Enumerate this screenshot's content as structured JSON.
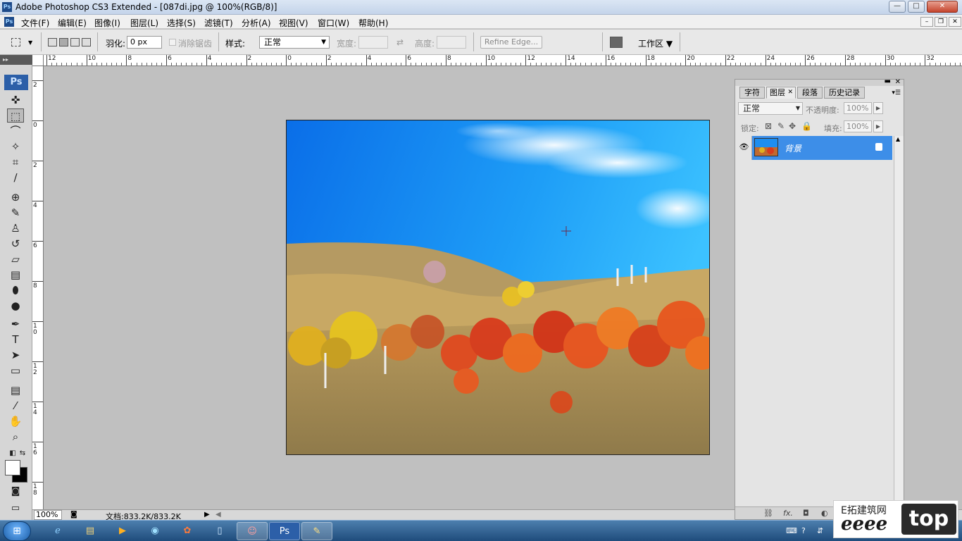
{
  "window": {
    "title": "Adobe Photoshop CS3 Extended - [087di.jpg @ 100%(RGB/8)]",
    "app_icon": "Ps",
    "min_label": "—",
    "max_label": "□",
    "close_label": "✕"
  },
  "menu": {
    "items": [
      "文件(F)",
      "编辑(E)",
      "图像(I)",
      "图层(L)",
      "选择(S)",
      "滤镜(T)",
      "分析(A)",
      "视图(V)",
      "窗口(W)",
      "帮助(H)"
    ],
    "doc_min": "–",
    "doc_restore": "❐",
    "doc_close": "✕"
  },
  "options": {
    "feather_label": "羽化:",
    "feather_value": "0 px",
    "antialias_label": "消除锯齿",
    "style_label": "样式:",
    "style_value": "正常",
    "width_label": "宽度:",
    "height_label": "高度:",
    "refine_edge": "Refine Edge...",
    "workspace_label": "工作区 ▼"
  },
  "toolbox": {
    "logo": "Ps",
    "tools": [
      {
        "name": "move-tool",
        "glyph": "✜"
      },
      {
        "name": "marquee-tool",
        "glyph": "⬚"
      },
      {
        "name": "lasso-tool",
        "glyph": "⌒"
      },
      {
        "name": "magic-wand-tool",
        "glyph": "✧"
      },
      {
        "name": "crop-tool",
        "glyph": "⌗"
      },
      {
        "name": "slice-tool",
        "glyph": "∕"
      },
      {
        "name": "healing-brush-tool",
        "glyph": "⊕"
      },
      {
        "name": "brush-tool",
        "glyph": "✎"
      },
      {
        "name": "clone-stamp-tool",
        "glyph": "♙"
      },
      {
        "name": "history-brush-tool",
        "glyph": "↺"
      },
      {
        "name": "eraser-tool",
        "glyph": "▱"
      },
      {
        "name": "gradient-tool",
        "glyph": "▤"
      },
      {
        "name": "blur-tool",
        "glyph": "⬮"
      },
      {
        "name": "dodge-tool",
        "glyph": "●"
      },
      {
        "name": "pen-tool",
        "glyph": "✒"
      },
      {
        "name": "type-tool",
        "glyph": "T"
      },
      {
        "name": "path-selection-tool",
        "glyph": "➤"
      },
      {
        "name": "shape-tool",
        "glyph": "▭"
      },
      {
        "name": "notes-tool",
        "glyph": "▤"
      },
      {
        "name": "eyedropper-tool",
        "glyph": "⁄"
      },
      {
        "name": "hand-tool",
        "glyph": "✋"
      },
      {
        "name": "zoom-tool",
        "glyph": "⌕"
      }
    ]
  },
  "rulers": {
    "top_labels": [
      "12",
      "10",
      "8",
      "6",
      "4",
      "2",
      "0",
      "2",
      "4",
      "6",
      "8",
      "10",
      "12",
      "14",
      "16",
      "18",
      "20",
      "22",
      "24",
      "26",
      "28",
      "30",
      "32"
    ],
    "left_labels": [
      "2",
      "0",
      "2",
      "4",
      "6",
      "8",
      "10",
      "12",
      "14",
      "16",
      "18"
    ]
  },
  "status": {
    "zoom": "100%",
    "doc_info": "文档:833.2K/833.2K"
  },
  "layers_panel": {
    "tabs": [
      "字符",
      "图层",
      "段落",
      "历史记录"
    ],
    "active_tab": "图层",
    "blend_mode": "正常",
    "opacity_label": "不透明度:",
    "opacity_value": "100%",
    "lock_label": "锁定:",
    "fill_label": "填充:",
    "fill_value": "100%",
    "layers": [
      {
        "name": "背景",
        "visible": true,
        "locked": true
      }
    ],
    "footer_icons": [
      "link-icon",
      "fx-icon",
      "mask-icon",
      "adjustment-icon"
    ]
  },
  "watermark": {
    "cn": "E拓建筑网",
    "brand": "eeee",
    "tld": "top"
  },
  "colors": {
    "accent": "#3d8ee8",
    "sky": "#1e90ff",
    "panel_bg": "#e4e4e4"
  }
}
